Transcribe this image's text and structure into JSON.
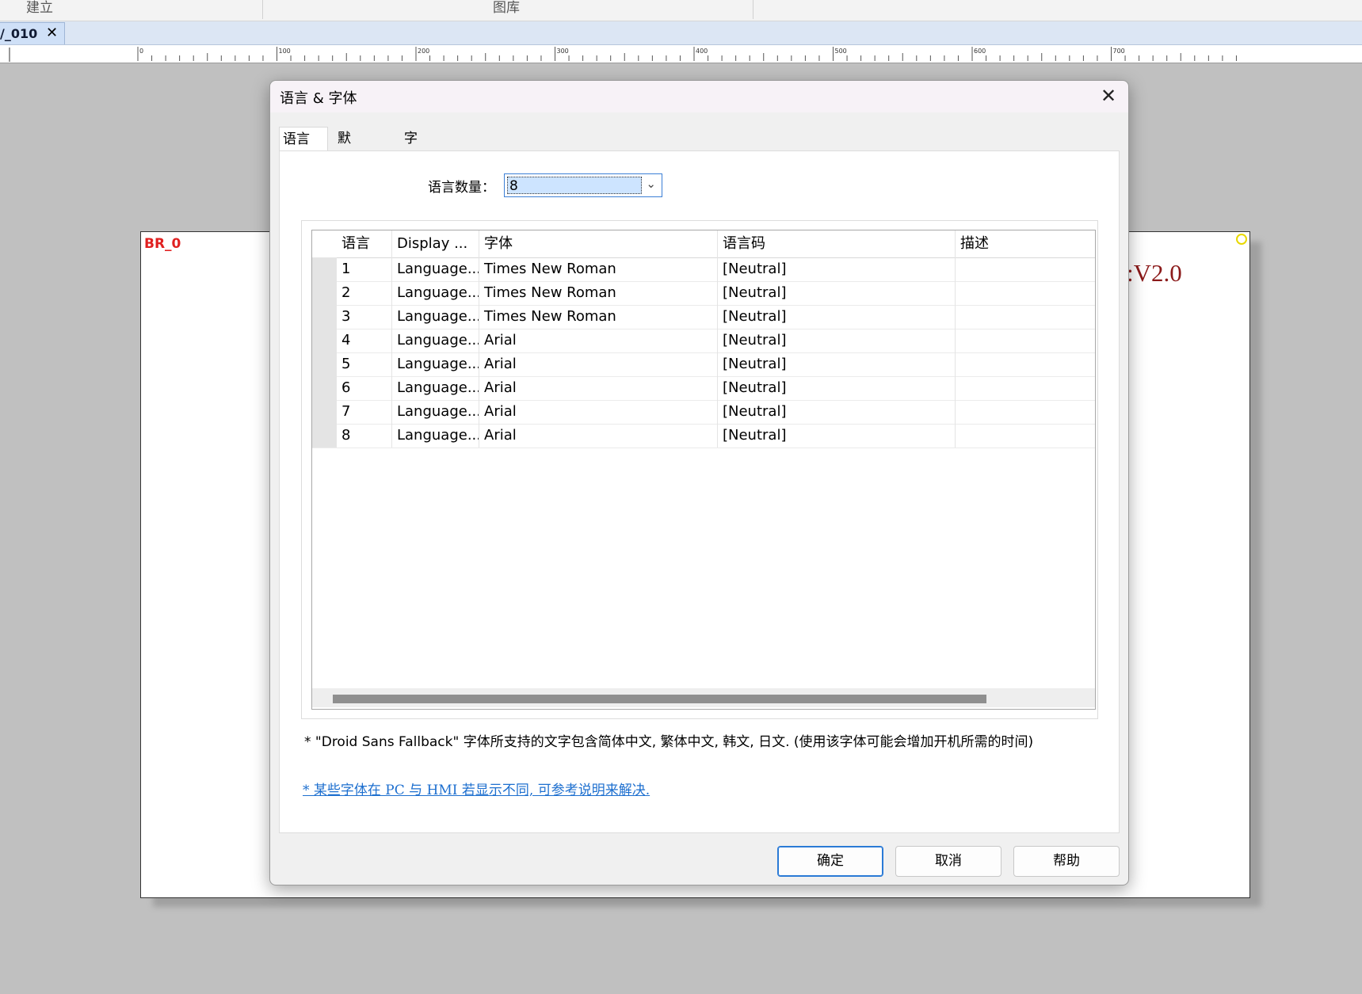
{
  "ribbon": {
    "build_label": "建立",
    "gallery_label": "图库"
  },
  "document_tab": {
    "label": "/_010",
    "close_glyph": "✕"
  },
  "ruler": {
    "marks": [
      "0",
      "100",
      "200",
      "300",
      "400",
      "500",
      "600",
      "700"
    ]
  },
  "page": {
    "tag_text": "BR_0",
    "version_text": ":V2.0"
  },
  "dialog": {
    "title": "语言 & 字体",
    "close_glyph": "✕",
    "tabs": [
      {
        "label": "语言",
        "active": true
      },
      {
        "label": "默认字体",
        "active": false
      },
      {
        "label": "字体管理",
        "active": false
      }
    ],
    "language_count": {
      "label": "语言数量：",
      "value": "8",
      "arrow_glyph": "⌄"
    },
    "grid": {
      "columns": [
        "语言",
        "Display ...",
        "字体",
        "语言码",
        "描述"
      ],
      "rows": [
        {
          "no": "1",
          "display": "Language...",
          "font": "Times New Roman",
          "code": "[Neutral]",
          "desc": ""
        },
        {
          "no": "2",
          "display": "Language...",
          "font": "Times New Roman",
          "code": "[Neutral]",
          "desc": ""
        },
        {
          "no": "3",
          "display": "Language...",
          "font": "Times New Roman",
          "code": "[Neutral]",
          "desc": ""
        },
        {
          "no": "4",
          "display": "Language...",
          "font": "Arial",
          "code": "[Neutral]",
          "desc": ""
        },
        {
          "no": "5",
          "display": "Language...",
          "font": "Arial",
          "code": "[Neutral]",
          "desc": ""
        },
        {
          "no": "6",
          "display": "Language...",
          "font": "Arial",
          "code": "[Neutral]",
          "desc": ""
        },
        {
          "no": "7",
          "display": "Language...",
          "font": "Arial",
          "code": "[Neutral]",
          "desc": ""
        },
        {
          "no": "8",
          "display": "Language...",
          "font": "Arial",
          "code": "[Neutral]",
          "desc": ""
        }
      ]
    },
    "note": "* \"Droid Sans Fallback\" 字体所支持的文字包含简体中文, 繁体中文, 韩文, 日文. (使用该字体可能会增加开机所需的时间)",
    "help_link": "* 某些字体在 PC 与 HMI 若显示不同, 可参考说明来解决.",
    "buttons": {
      "ok": "确定",
      "cancel": "取消",
      "help": "帮助"
    }
  },
  "colors": {
    "accent": "#2a7ad6",
    "link": "#1d6fcf",
    "page_tag": "#e02020",
    "version_text": "#8b1a1a"
  }
}
